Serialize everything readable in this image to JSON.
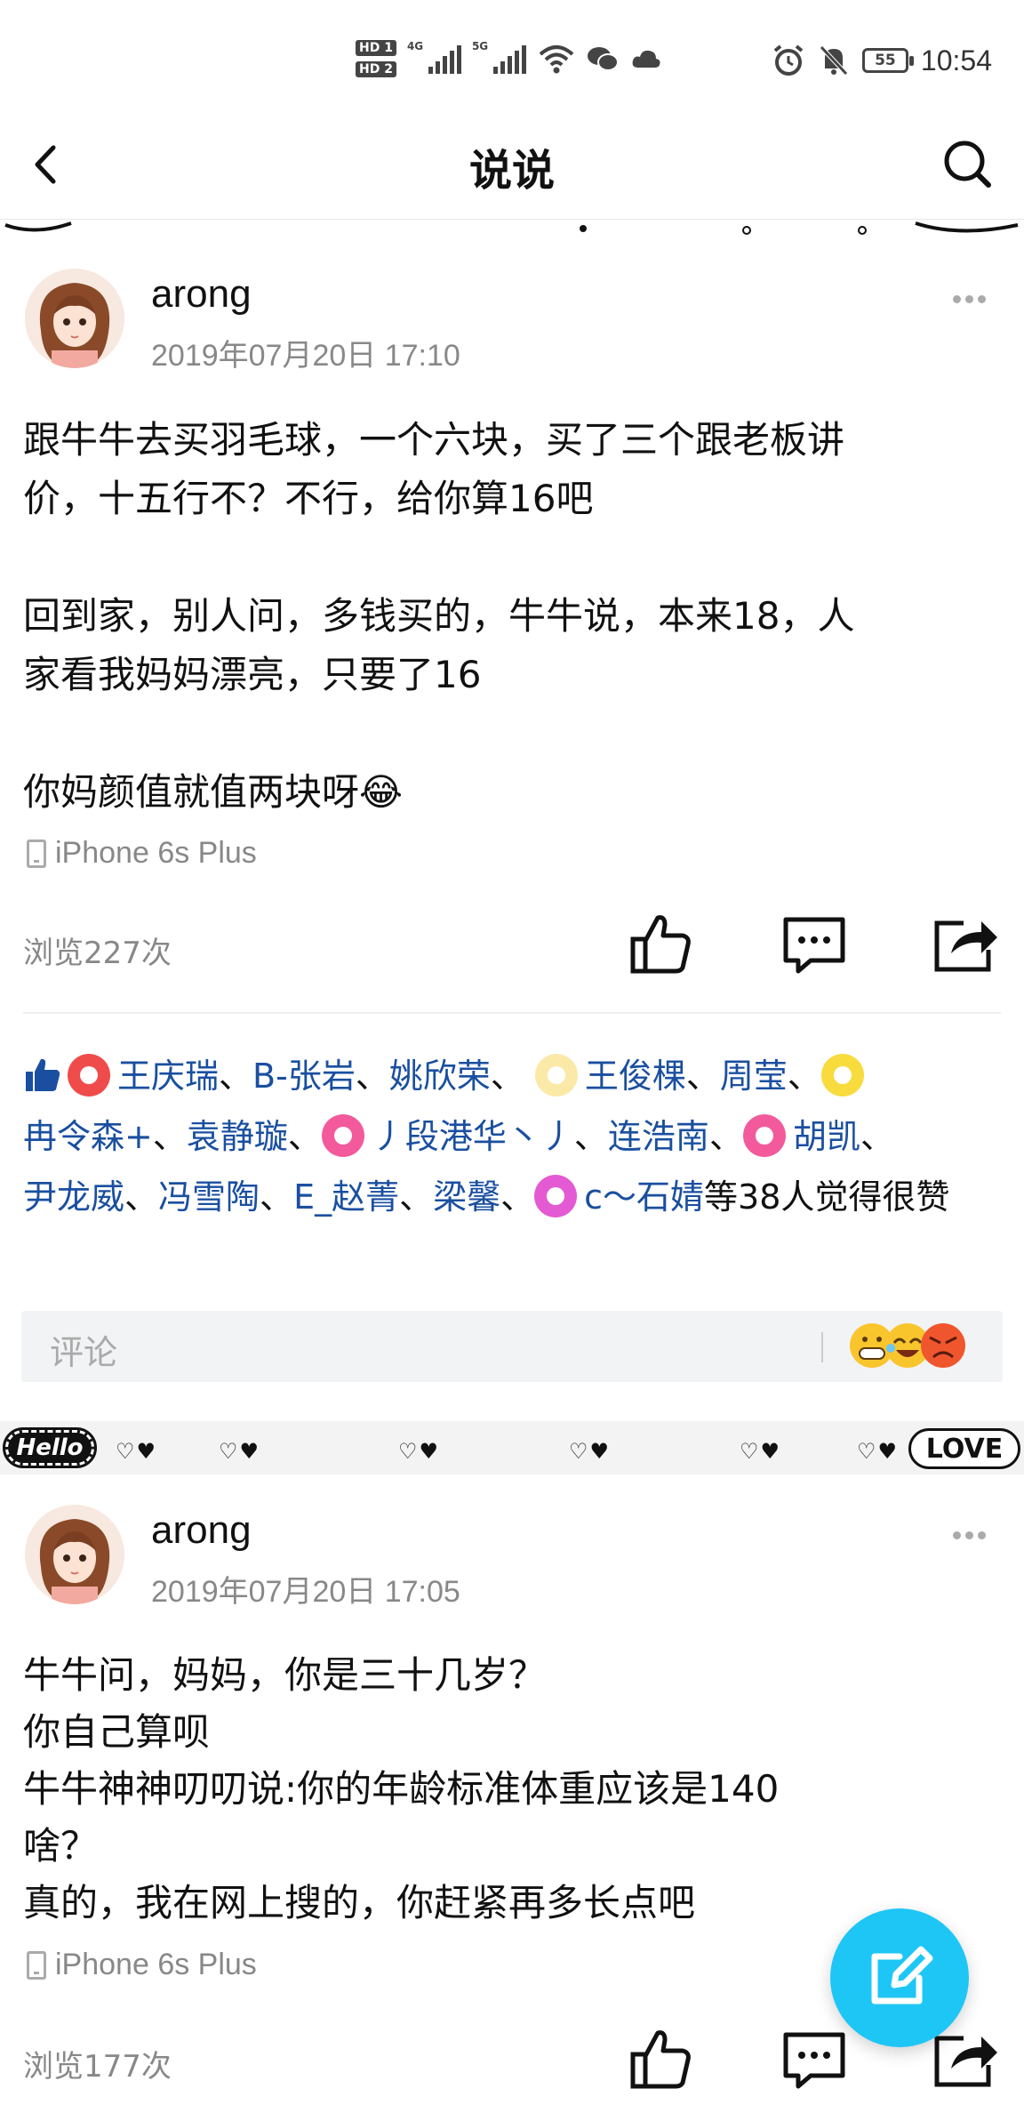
{
  "status_bar": {
    "hd1": "HD 1",
    "hd2": "HD 2",
    "net1": "4G",
    "net2": "5G",
    "battery": "55",
    "time": "10:54"
  },
  "navbar": {
    "title": "说说"
  },
  "decorations": {
    "hello": "Hello",
    "love": "LOVE",
    "hearts": "♡♥"
  },
  "posts": [
    {
      "author": "arong",
      "time": "2019年07月20日 17:10",
      "content": [
        "跟牛牛去买羽毛球，一个六块，买了三个跟老板讲",
        "价，十五行不？不行，给你算16吧",
        "",
        "回到家，别人问，多钱买的，牛牛说，本来18，人",
        "家看我妈妈漂亮，只要了16",
        "",
        "你妈颜值就值两块呀😂"
      ],
      "device": "iPhone 6s Plus",
      "views": "浏览227次",
      "likes": {
        "names": [
          "王庆瑞",
          "B-张岩",
          "姚欣荣",
          "王俊棵",
          "周莹",
          "冉令森+",
          "袁静璇",
          "丿段港华丶丿",
          "连浩南",
          "胡凯",
          "尹龙威",
          "冯雪陶",
          "E_赵菁",
          "梁馨",
          "c～石婧"
        ],
        "separator": "、",
        "suffix": "等38人觉得很赞"
      }
    },
    {
      "author": "arong",
      "time": "2019年07月20日 17:05",
      "content": [
        "牛牛问，妈妈，你是三十几岁？",
        "你自己算呗",
        "牛牛神神叨叨说:你的年龄标准体重应该是140",
        "啥？",
        "真的，我在网上搜的，你赶紧再多长点吧"
      ],
      "device": "iPhone 6s Plus",
      "views": "浏览177次"
    }
  ],
  "comment": {
    "placeholder": "评论"
  },
  "colors": {
    "accent": "#1ec6f5",
    "link": "#1a4fa0"
  }
}
